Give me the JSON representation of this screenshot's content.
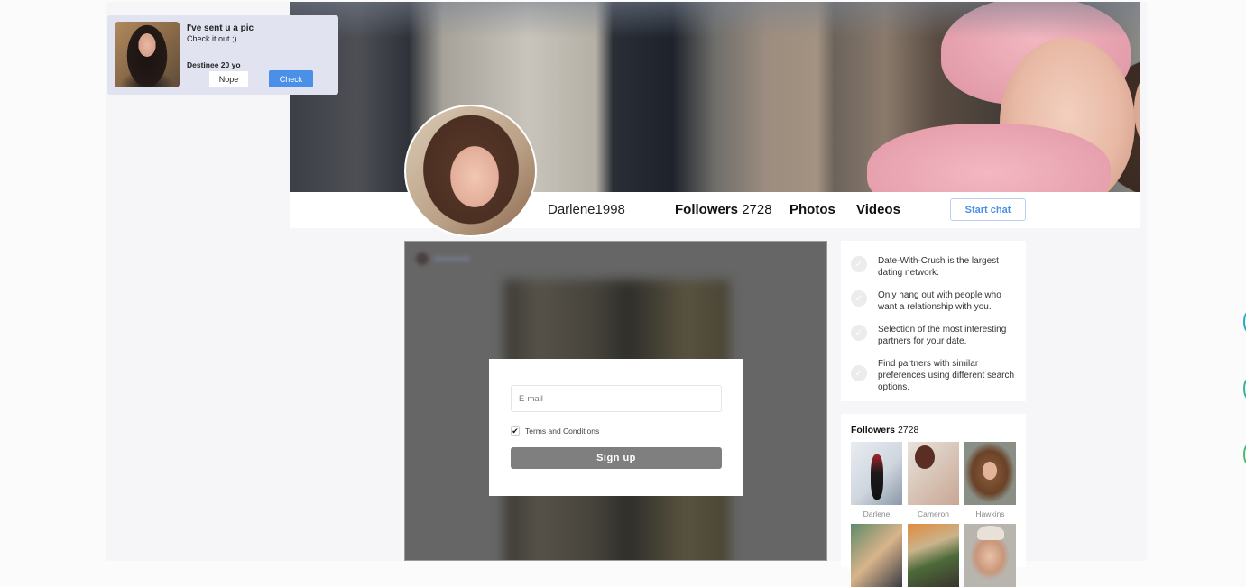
{
  "notification": {
    "title": "I've sent u a pic",
    "subtitle": "Check it out ;)",
    "sender": "Destinee 20 yo",
    "decline_label": "Nope",
    "accept_label": "Check"
  },
  "profile": {
    "username": "Darlene1998",
    "followers_label": "Followers",
    "followers_count": "2728",
    "photos_label": "Photos",
    "videos_label": "Videos",
    "start_chat_label": "Start chat"
  },
  "signup": {
    "email_placeholder": "E-mail",
    "email_value": "",
    "terms_checked": true,
    "terms_label": "Terms and Conditions",
    "submit_label": "Sign up"
  },
  "benefits": [
    {
      "icon": "check-circle-icon",
      "text": "Date-With-Crush is the largest dating network."
    },
    {
      "icon": "check-circle-icon",
      "text": "Only hang out with people who want a relationship with you."
    },
    {
      "icon": "check-circle-icon",
      "text": "Selection of the most interesting partners for your date."
    },
    {
      "icon": "check-circle-icon",
      "text": "Find partners with similar preferences using different search options."
    }
  ],
  "followers_panel": {
    "title": "Followers",
    "count": "2728",
    "items": [
      {
        "name": "Darlene"
      },
      {
        "name": "Cameron"
      },
      {
        "name": "Hawkins"
      },
      {
        "name": ""
      },
      {
        "name": ""
      },
      {
        "name": ""
      }
    ]
  },
  "colors": {
    "accent": "#4a90e8",
    "notification_bg": "#e1e3f0",
    "signup_button": "#7f7f7f",
    "side_dots": [
      "#2aa6c9",
      "#37b39a",
      "#4cbb6a"
    ]
  }
}
